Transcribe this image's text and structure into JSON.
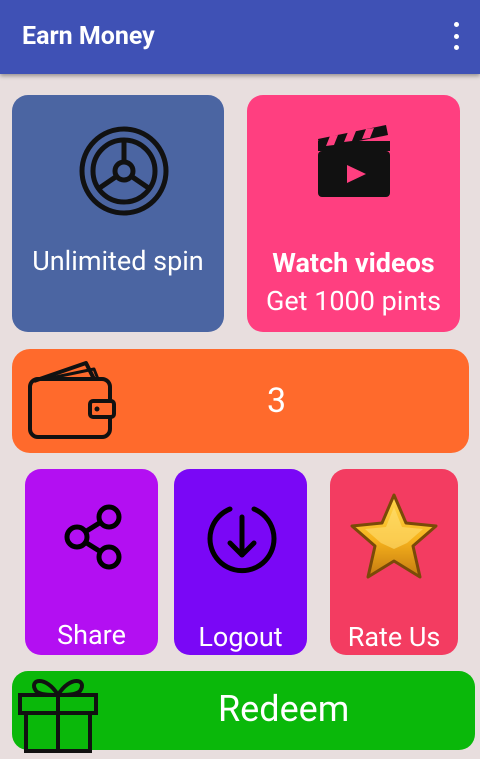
{
  "app": {
    "title": "Earn Money"
  },
  "tiles": {
    "spin": {
      "label": "Unlimited spin"
    },
    "videos": {
      "title": "Watch videos",
      "subtitle": "Get 1000 pints"
    },
    "wallet": {
      "balance": "3"
    },
    "share": {
      "label": "Share"
    },
    "logout": {
      "label": "Logout"
    },
    "rate": {
      "label": "Rate Us"
    },
    "redeem": {
      "label": "Redeem"
    }
  },
  "colors": {
    "appbar": "#3f51b5",
    "spin": "#4b65a2",
    "videos": "#ff3f80",
    "wallet": "#ff6a2c",
    "share": "#b30ff2",
    "logout": "#7a07f6",
    "rate": "#f33c61",
    "redeem": "#0ab80a"
  },
  "icons": {
    "spin": "steering-wheel-icon",
    "videos": "clapperboard-icon",
    "wallet": "wallet-icon",
    "share": "share-icon",
    "logout": "download-circle-icon",
    "rate": "star-icon",
    "redeem": "gift-icon",
    "menu": "more-vert-icon"
  }
}
